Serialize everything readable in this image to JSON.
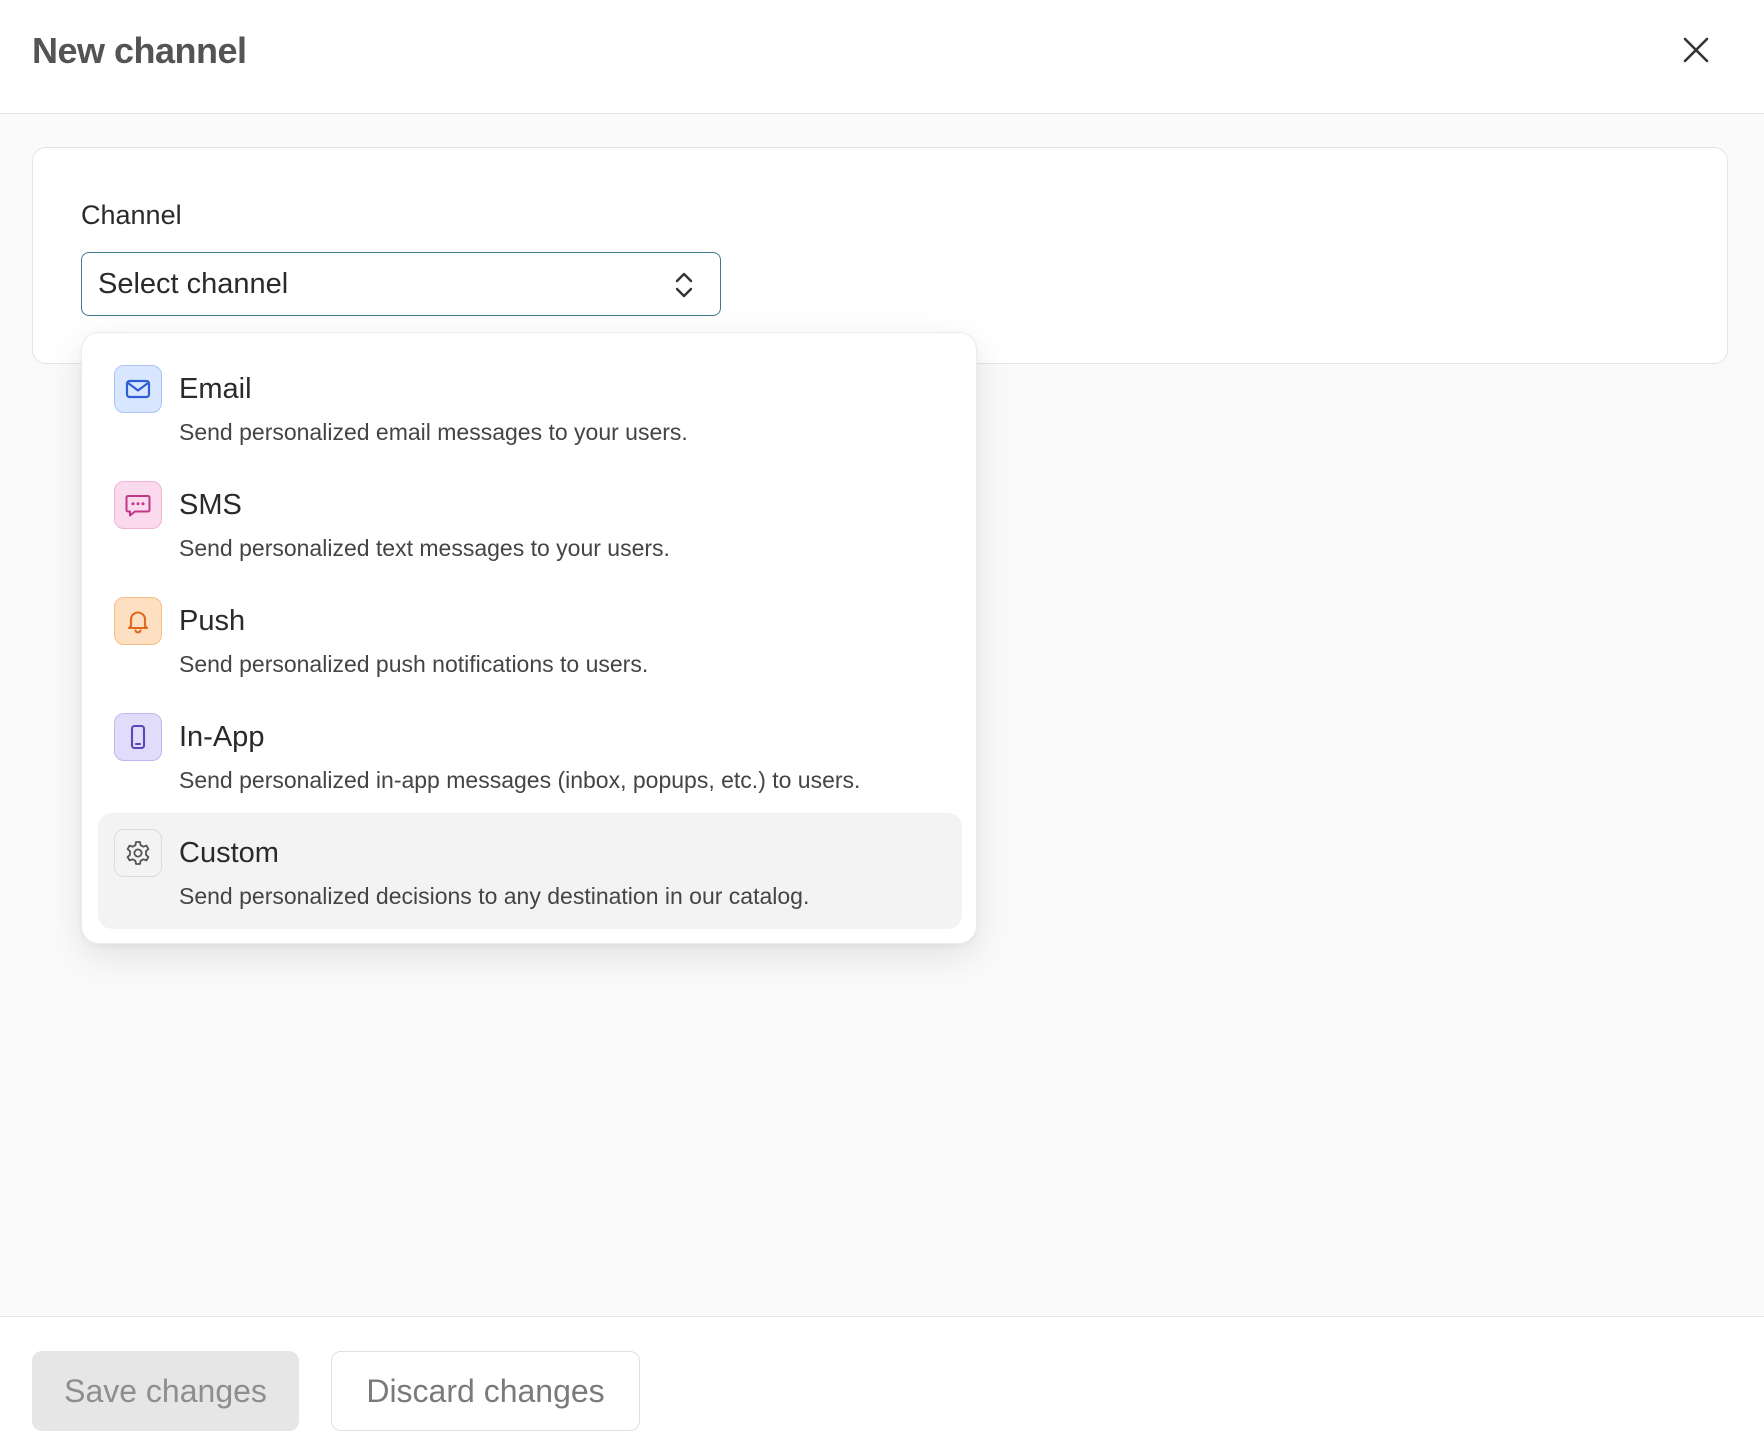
{
  "header": {
    "title": "New channel"
  },
  "form": {
    "channel_label": "Channel",
    "select_value": "Select channel"
  },
  "dropdown": {
    "options": [
      {
        "title": "Email",
        "description": "Send personalized email messages to your users.",
        "icon": "mail-icon",
        "icon_bg": "#d9e6ff",
        "icon_border": "#aac4f5",
        "icon_color": "#2f5fd6"
      },
      {
        "title": "SMS",
        "description": "Send personalized text messages to your users.",
        "icon": "message-icon",
        "icon_bg": "#fbdaee",
        "icon_border": "#efb3d6",
        "icon_color": "#c23689"
      },
      {
        "title": "Push",
        "description": "Send personalized push notifications to users.",
        "icon": "bell-icon",
        "icon_bg": "#fde0c2",
        "icon_border": "#f6bd85",
        "icon_color": "#e0681c"
      },
      {
        "title": "In-App",
        "description": "Send personalized in-app messages (inbox, popups, etc.) to users.",
        "icon": "phone-icon",
        "icon_bg": "#e2dcfb",
        "icon_border": "#c2b6f0",
        "icon_color": "#5b48b8"
      },
      {
        "title": "Custom",
        "description": "Send personalized decisions to any destination in our catalog.",
        "icon": "gear-icon",
        "icon_bg": "#f3f3f3",
        "icon_border": "#dcdcdc",
        "icon_color": "#555555"
      }
    ],
    "highlighted_index": 4
  },
  "footer": {
    "save_label": "Save changes",
    "discard_label": "Discard changes"
  }
}
